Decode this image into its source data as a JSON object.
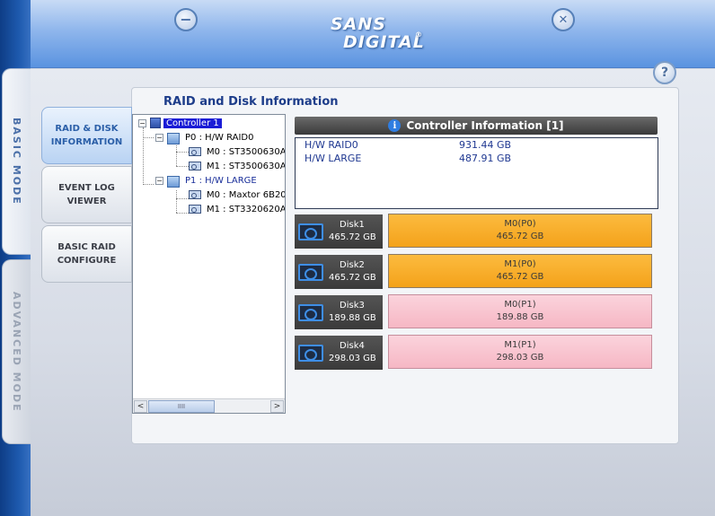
{
  "header": {
    "logo_line1": "SANS",
    "logo_line2": "DIGITAL",
    "logo_reg": "®",
    "minimize_glyph": "−",
    "close_glyph": "✕",
    "help_glyph": "?"
  },
  "modes": {
    "basic": "BASIC MODE",
    "advanced": "ADVANCED MODE"
  },
  "nav": [
    {
      "line1": "RAID & DISK",
      "line2": "INFORMATION"
    },
    {
      "line1": "EVENT LOG",
      "line2": "VIEWER"
    },
    {
      "line1": "BASIC RAID",
      "line2": "CONFIGURE"
    }
  ],
  "panel_title": "RAID and Disk Information",
  "tree": {
    "controller": "Controller 1",
    "p0": "P0 : H/W RAID0",
    "p0_m0": "M0 : ST3500630A",
    "p0_m1": "M1 : ST3500630A",
    "p1": "P1 : H/W LARGE",
    "p1_m0": "M0 : Maxtor 6B20",
    "p1_m1": "M1 : ST3320620A",
    "scroll_left": "<",
    "scroll_right": ">",
    "thumb_grip": "IIII"
  },
  "controller_info": {
    "title": "Controller Information  [1]",
    "info_glyph": "i",
    "rows": [
      {
        "name": "H/W RAID0",
        "size": "931.44 GB"
      },
      {
        "name": "H/W LARGE",
        "size": "487.91 GB"
      }
    ]
  },
  "disks": [
    {
      "name": "Disk1",
      "size": "465.72 GB",
      "member": "M0(P0)",
      "member_size": "465.72 GB",
      "color": "#f8ac26"
    },
    {
      "name": "Disk2",
      "size": "465.72 GB",
      "member": "M1(P0)",
      "member_size": "465.72 GB",
      "color": "#f8ac26"
    },
    {
      "name": "Disk3",
      "size": "189.88 GB",
      "member": "M0(P1)",
      "member_size": "189.88 GB",
      "color": "#f8c4cf"
    },
    {
      "name": "Disk4",
      "size": "298.03 GB",
      "member": "M1(P1)",
      "member_size": "298.03 GB",
      "color": "#f8c4cf"
    }
  ]
}
